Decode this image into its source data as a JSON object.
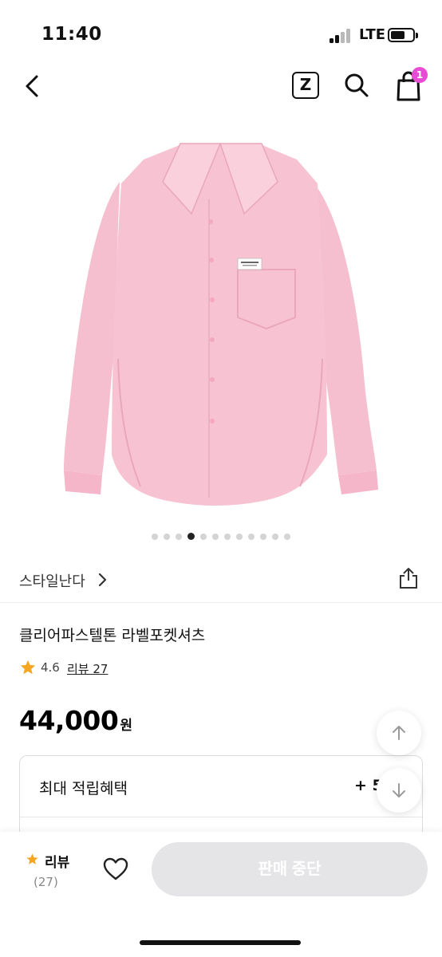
{
  "status_bar": {
    "time": "11:40",
    "network": "LTE"
  },
  "header": {
    "z_label": "Z",
    "cart_count": "1"
  },
  "gallery": {
    "total_images": 12,
    "active_index": 3
  },
  "brand": {
    "name": "스타일난다"
  },
  "product": {
    "title": "클리어파스텔톤 라벨포켓셔츠",
    "rating": "4.6",
    "review_link": "리뷰 27",
    "price": "44,000",
    "currency": "원"
  },
  "benefit": {
    "label": "최대 적립혜택",
    "value": "+ 5"
  },
  "bottom_bar": {
    "review_label": "리뷰",
    "review_count": "(27)",
    "cta_label": "판매 중단"
  },
  "colors": {
    "accent": "#e84bd6",
    "star": "#f5a623",
    "shirt": "#f7c3d2",
    "cta_disabled": "#e5e5e8"
  }
}
